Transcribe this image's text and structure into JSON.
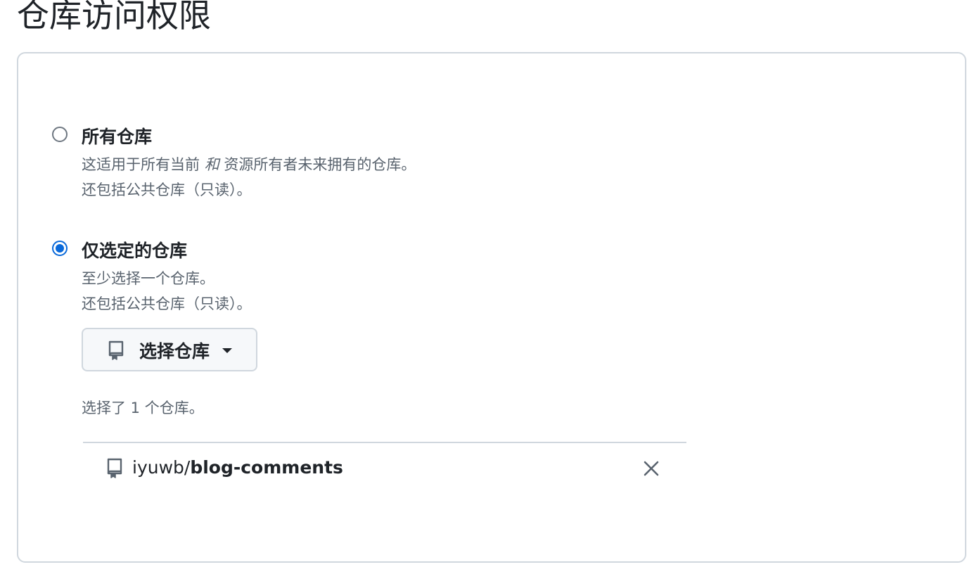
{
  "page": {
    "title": "仓库访问权限"
  },
  "options": {
    "all": {
      "label": "所有仓库",
      "desc_before": "这适用于所有当前 ",
      "desc_em": "和",
      "desc_after": " 资源所有者未来拥有的仓库。",
      "desc_line2": "还包括公共仓库（只读）。",
      "checked": false
    },
    "selected": {
      "label": "仅选定的仓库",
      "desc_line1": "至少选择一个仓库。",
      "desc_line2": "还包括公共仓库（只读）。",
      "checked": true
    }
  },
  "select_button": {
    "label": "选择仓库",
    "icon": "repo-icon"
  },
  "selection": {
    "count_text": "选择了 1 个仓库。",
    "repos": [
      {
        "owner": "iyuwb/",
        "name": "blog-comments"
      }
    ]
  },
  "colors": {
    "accent": "#0969da",
    "border": "#d0d7de",
    "muted_text": "#59636e",
    "text": "#1f2328"
  }
}
